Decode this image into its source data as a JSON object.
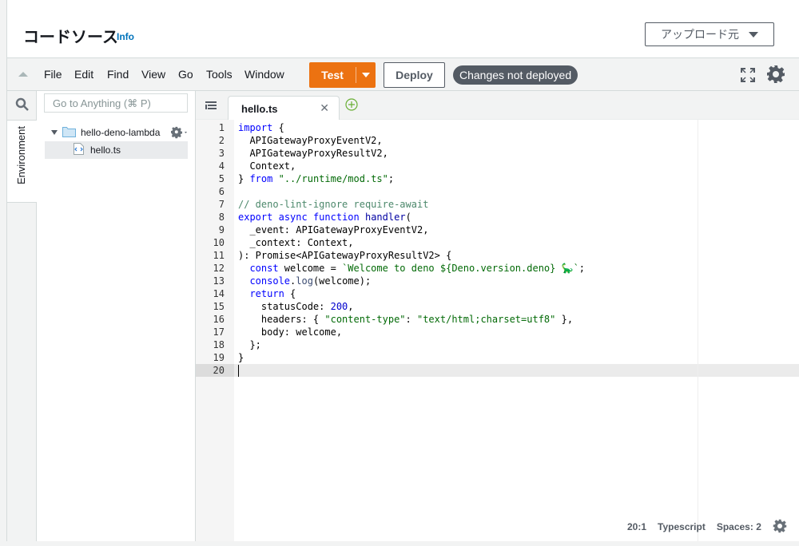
{
  "header": {
    "title": "コードソース",
    "info_link": "Info",
    "upload_button": "アップロード元"
  },
  "menu": {
    "items": [
      "File",
      "Edit",
      "Find",
      "View",
      "Go",
      "Tools",
      "Window"
    ],
    "test_label": "Test",
    "deploy_label": "Deploy",
    "status_badge": "Changes not deployed"
  },
  "sidebar": {
    "environment_tab": "Environment",
    "search_placeholder": "Go to Anything (⌘ P)",
    "folder_name": "hello-deno-lambda",
    "file_name": "hello.ts"
  },
  "editor": {
    "tab_label": "hello.ts",
    "line_numbers": [
      "1",
      "2",
      "3",
      "4",
      "5",
      "6",
      "7",
      "8",
      "9",
      "10",
      "11",
      "12",
      "13",
      "14",
      "15",
      "16",
      "17",
      "18",
      "19",
      "20"
    ]
  },
  "status": {
    "position": "20:1",
    "language": "Typescript",
    "spaces": "Spaces: 2"
  },
  "colors": {
    "accent_orange": "#ec7211",
    "badge_gray": "#545b64",
    "info_blue": "#0073bb"
  }
}
